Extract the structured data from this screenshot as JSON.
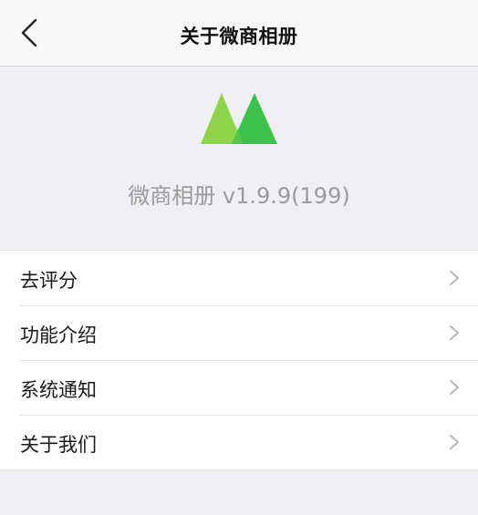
{
  "navbar": {
    "title": "关于微商相册",
    "back_icon": "chevron-left-icon"
  },
  "header": {
    "logo_icon": "mountain-logo-icon",
    "version_text": "微商相册 v1.9.9(199)",
    "logo_colors": [
      "#8fd34a",
      "#3cc24c"
    ]
  },
  "menu": {
    "items": [
      {
        "label": "去评分",
        "icon": "chevron-right-icon"
      },
      {
        "label": "功能介绍",
        "icon": "chevron-right-icon"
      },
      {
        "label": "系统通知",
        "icon": "chevron-right-icon"
      },
      {
        "label": "关于我们",
        "icon": "chevron-right-icon"
      }
    ]
  }
}
